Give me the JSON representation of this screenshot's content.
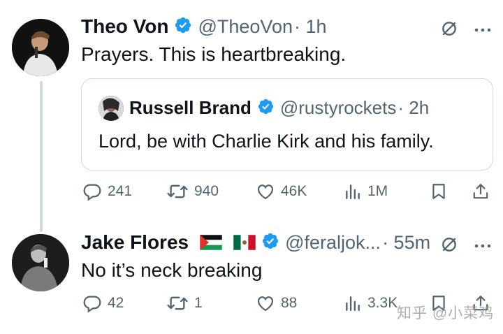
{
  "tweet1": {
    "name": "Theo Von",
    "handle": "@TheoVon",
    "time": "· 1h",
    "text": "Prayers. This is heartbreaking.",
    "quote": {
      "name": "Russell Brand",
      "handle": "@rustyrockets",
      "time": "· 2h",
      "text": "Lord, be with Charlie Kirk and his family."
    },
    "actions": {
      "replies": "241",
      "reposts": "940",
      "likes": "46K",
      "views": "1M"
    }
  },
  "tweet2": {
    "name": "Jake Flores",
    "handle": "@feraljok...",
    "time": "· 55m",
    "text": "No it’s neck breaking",
    "actions": {
      "replies": "42",
      "reposts": "1",
      "likes": "88",
      "views": "3.3K"
    }
  },
  "watermark": "知乎 @小菜鸡",
  "colors": {
    "verified": "#1d9bf0",
    "secondary_text": "#536471",
    "border": "#cfd9de"
  },
  "icons": [
    "verified-badge-icon",
    "grok-icon",
    "more-icon",
    "reply-icon",
    "repost-icon",
    "like-icon",
    "views-icon",
    "bookmark-icon",
    "share-icon",
    "palestine-flag-icon",
    "mexico-flag-icon"
  ]
}
